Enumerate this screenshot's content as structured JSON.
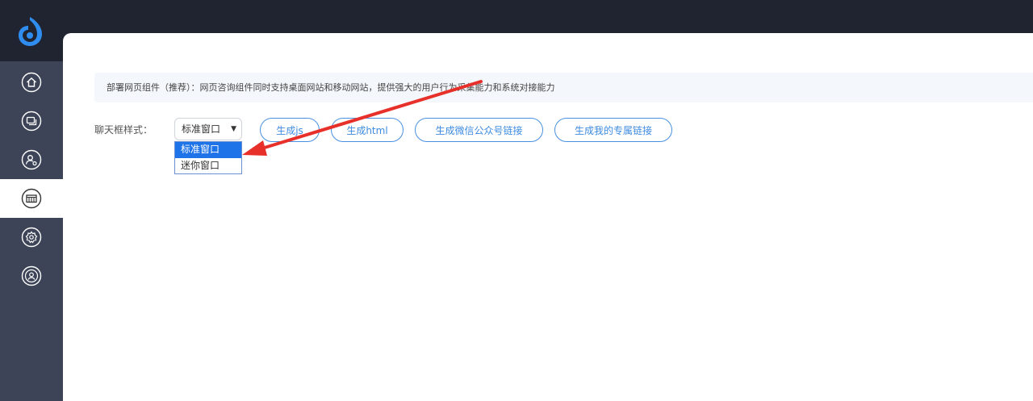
{
  "nav": {
    "items": [
      {
        "icon": "home-icon",
        "active": false
      },
      {
        "icon": "chat-icon",
        "active": false
      },
      {
        "icon": "user-settings-icon",
        "active": false
      },
      {
        "icon": "widget-icon",
        "active": true
      },
      {
        "icon": "gear-icon",
        "active": false
      },
      {
        "icon": "account-icon",
        "active": false
      }
    ]
  },
  "main": {
    "notice": "部署网页组件（推荐）：网页咨询组件同时支持桌面网站和移动网站，提供强大的用户行为采集能力和系统对接能力",
    "style_label": "聊天框样式：",
    "select": {
      "value": "标准窗口",
      "options": [
        "标准窗口",
        "迷你窗口"
      ]
    },
    "buttons": {
      "js": "生成js",
      "html": "生成html",
      "wechat": "生成微信公众号链接",
      "link": "生成我的专属链接"
    }
  },
  "colors": {
    "topbar": "#202431",
    "sidebar": "#3d4458",
    "accent": "#4a90e2",
    "annotation_arrow": "#e8302a"
  }
}
